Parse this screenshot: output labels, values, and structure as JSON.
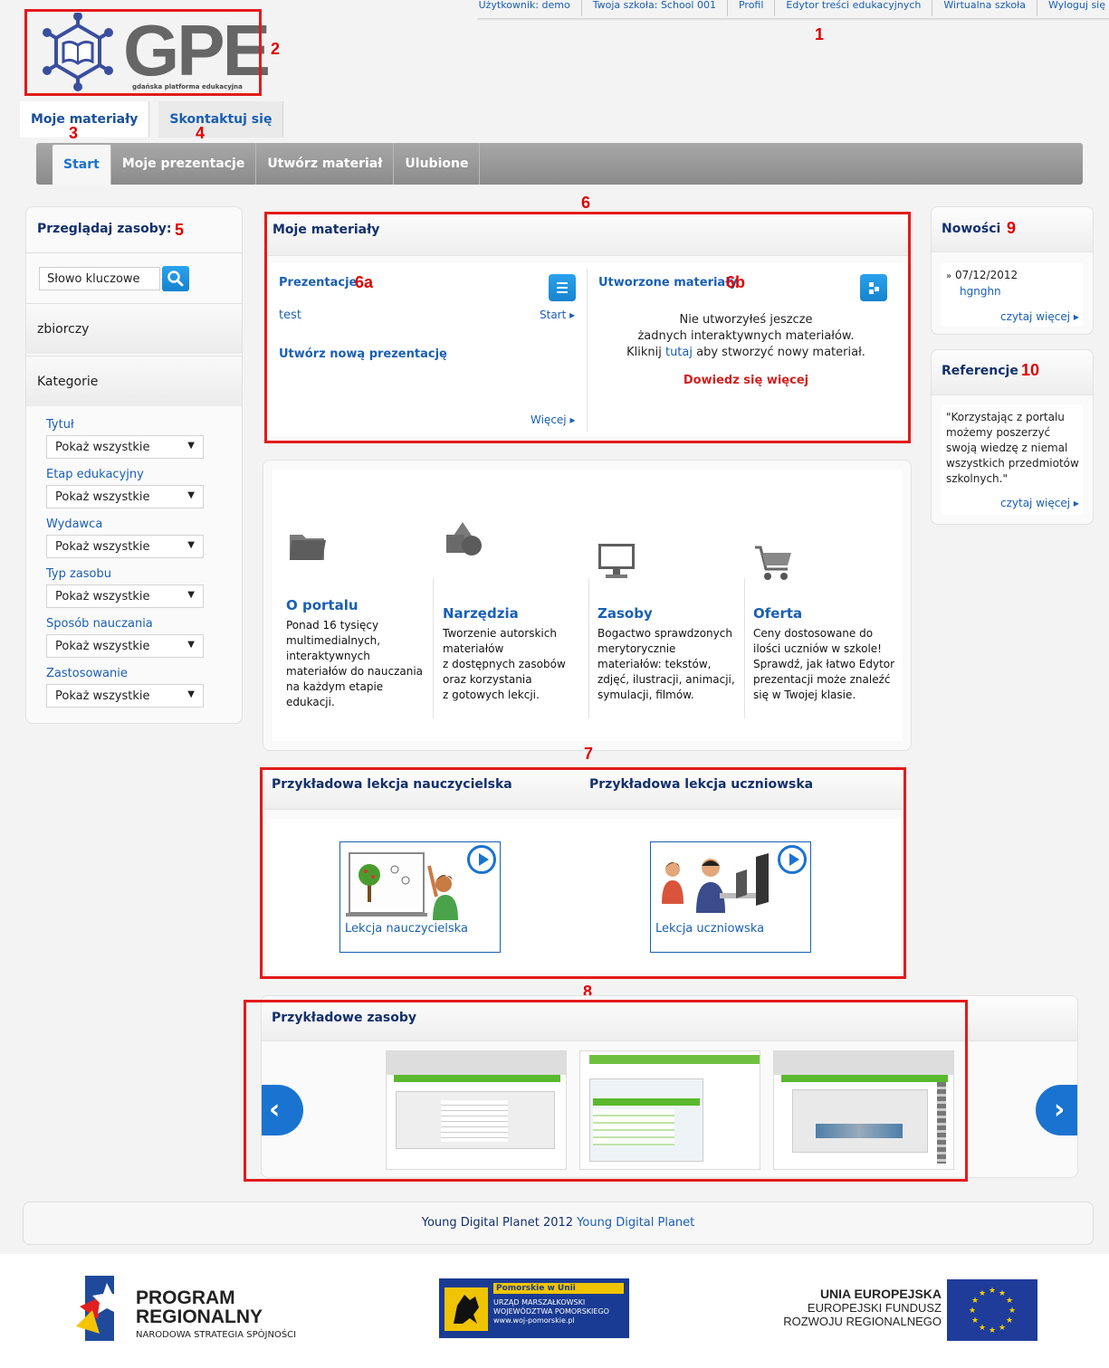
{
  "topnav": {
    "user_label": "Użytkownik:",
    "user_value": "demo",
    "school": "Twoja szkoła: School 001",
    "profile": "Profil",
    "editor": "Edytor treści edukacyjnych",
    "virtual_school": "Wirtualna szkoła",
    "logout": "Wyloguj się"
  },
  "logo": {
    "text": "GPE",
    "subtitle": "gdańska platforma edukacyjna"
  },
  "main_tabs": [
    "Moje materiały",
    "Skontaktuj się"
  ],
  "sub_nav": [
    "Start",
    "Moje prezentacje",
    "Utwórz materiał",
    "Ulubione"
  ],
  "annotations": {
    "n1": "1",
    "n2": "2",
    "n3": "3",
    "n4": "4",
    "n5": "5",
    "n6": "6",
    "n6a": "6a",
    "n6b": "6b",
    "n7": "7",
    "n8": "8",
    "n9": "9",
    "n10": "10"
  },
  "sidebar": {
    "title": "Przeglądaj zasoby:",
    "search_placeholder": "Słowo kluczowe",
    "zbiorczy": "zbiorczy",
    "kategorie": "Kategorie",
    "filters": [
      {
        "label": "Tytuł",
        "value": "Pokaż wszystkie"
      },
      {
        "label": "Etap edukacyjny",
        "value": "Pokaż wszystkie"
      },
      {
        "label": "Wydawca",
        "value": "Pokaż wszystkie"
      },
      {
        "label": "Typ zasobu",
        "value": "Pokaż wszystkie"
      },
      {
        "label": "Sposób nauczania",
        "value": "Pokaż wszystkie"
      },
      {
        "label": "Zastosowanie",
        "value": "Pokaż wszystkie"
      }
    ]
  },
  "my_materials": {
    "title": "Moje materiały",
    "presentations": {
      "title": "Prezentacje",
      "item": "test",
      "start": "Start",
      "create": "Utwórz nową prezentację",
      "more": "Więcej"
    },
    "created": {
      "title": "Utworzone materiały",
      "line1": "Nie utworzyłeś jeszcze",
      "line2": "żadnych interaktywnych materiałów.",
      "line3_a": "Kliknij",
      "line3_link": "tutaj",
      "line3_b": "aby stworzyć nowy materiał.",
      "learn_more": "Dowiedz się więcej"
    }
  },
  "features": [
    {
      "title": "O portalu",
      "text": [
        "Ponad 16 tysięcy",
        "multimedialnych,",
        "interaktywnych",
        "materiałów do nauczania",
        "na każdym etapie",
        "edukacji."
      ],
      "icon": "folder-icon"
    },
    {
      "title": "Narzędzia",
      "text": [
        "Tworzenie autorskich",
        "materiałów",
        "z dostępnych zasobów",
        "oraz korzystania",
        "z gotowych lekcji."
      ],
      "icon": "shapes-icon"
    },
    {
      "title": "Zasoby",
      "text": [
        "Bogactwo sprawdzonych",
        "merytorycznie",
        "materiałów: tekstów,",
        "zdjęć, ilustracji, animacji,",
        "symulacji, filmów."
      ],
      "icon": "monitor-icon"
    },
    {
      "title": "Oferta",
      "text": [
        "Ceny dostosowane do",
        "ilości uczniów w szkole!",
        "Sprawdź, jak łatwo Edytor",
        "prezentacji może znaleźć",
        "się w Twojej klasie."
      ],
      "icon": "cart-icon"
    }
  ],
  "lessons": {
    "teacher_title": "Przykładowa lekcja nauczycielska",
    "student_title": "Przykładowa lekcja uczniowska",
    "teacher_link": "Lekcja nauczycielska",
    "student_link": "Lekcja uczniowska"
  },
  "resources": {
    "title": "Przykładowe zasoby"
  },
  "news": {
    "title": "Nowości",
    "date": "07/12/2012",
    "text": "hgnghn",
    "more": "czytaj więcej"
  },
  "references": {
    "title": "Referencje",
    "quote": [
      "\"Korzystając z portalu",
      "możemy poszerzyć",
      "swoją wiedzę z niemal",
      "wszystkich przedmiotów",
      "szkolnych.\""
    ],
    "more": "czytaj więcej"
  },
  "footer": {
    "text": "Young Digital Planet 2012",
    "link": "Young Digital Planet"
  },
  "eu": {
    "program1": "PROGRAM",
    "program2": "REGIONALNY",
    "program3": "NARODOWA STRATEGIA SPÓJNOŚCI",
    "pom1": "Pomorskie w Unii",
    "pom2": "URZĄD MARSZAŁKOWSKI",
    "pom3": "WOJEWÓDZTWA POMORSKIEGO",
    "pom4": "www.woj-pomorskie.pl",
    "ue1": "UNIA EUROPEJSKA",
    "ue2": "EUROPEJSKI FUNDUSZ",
    "ue3": "ROZWOJU REGIONALNEGO"
  },
  "colors": {
    "accent": "#1a73d0",
    "annotation": "#e21b1b",
    "title": "#13306b"
  }
}
